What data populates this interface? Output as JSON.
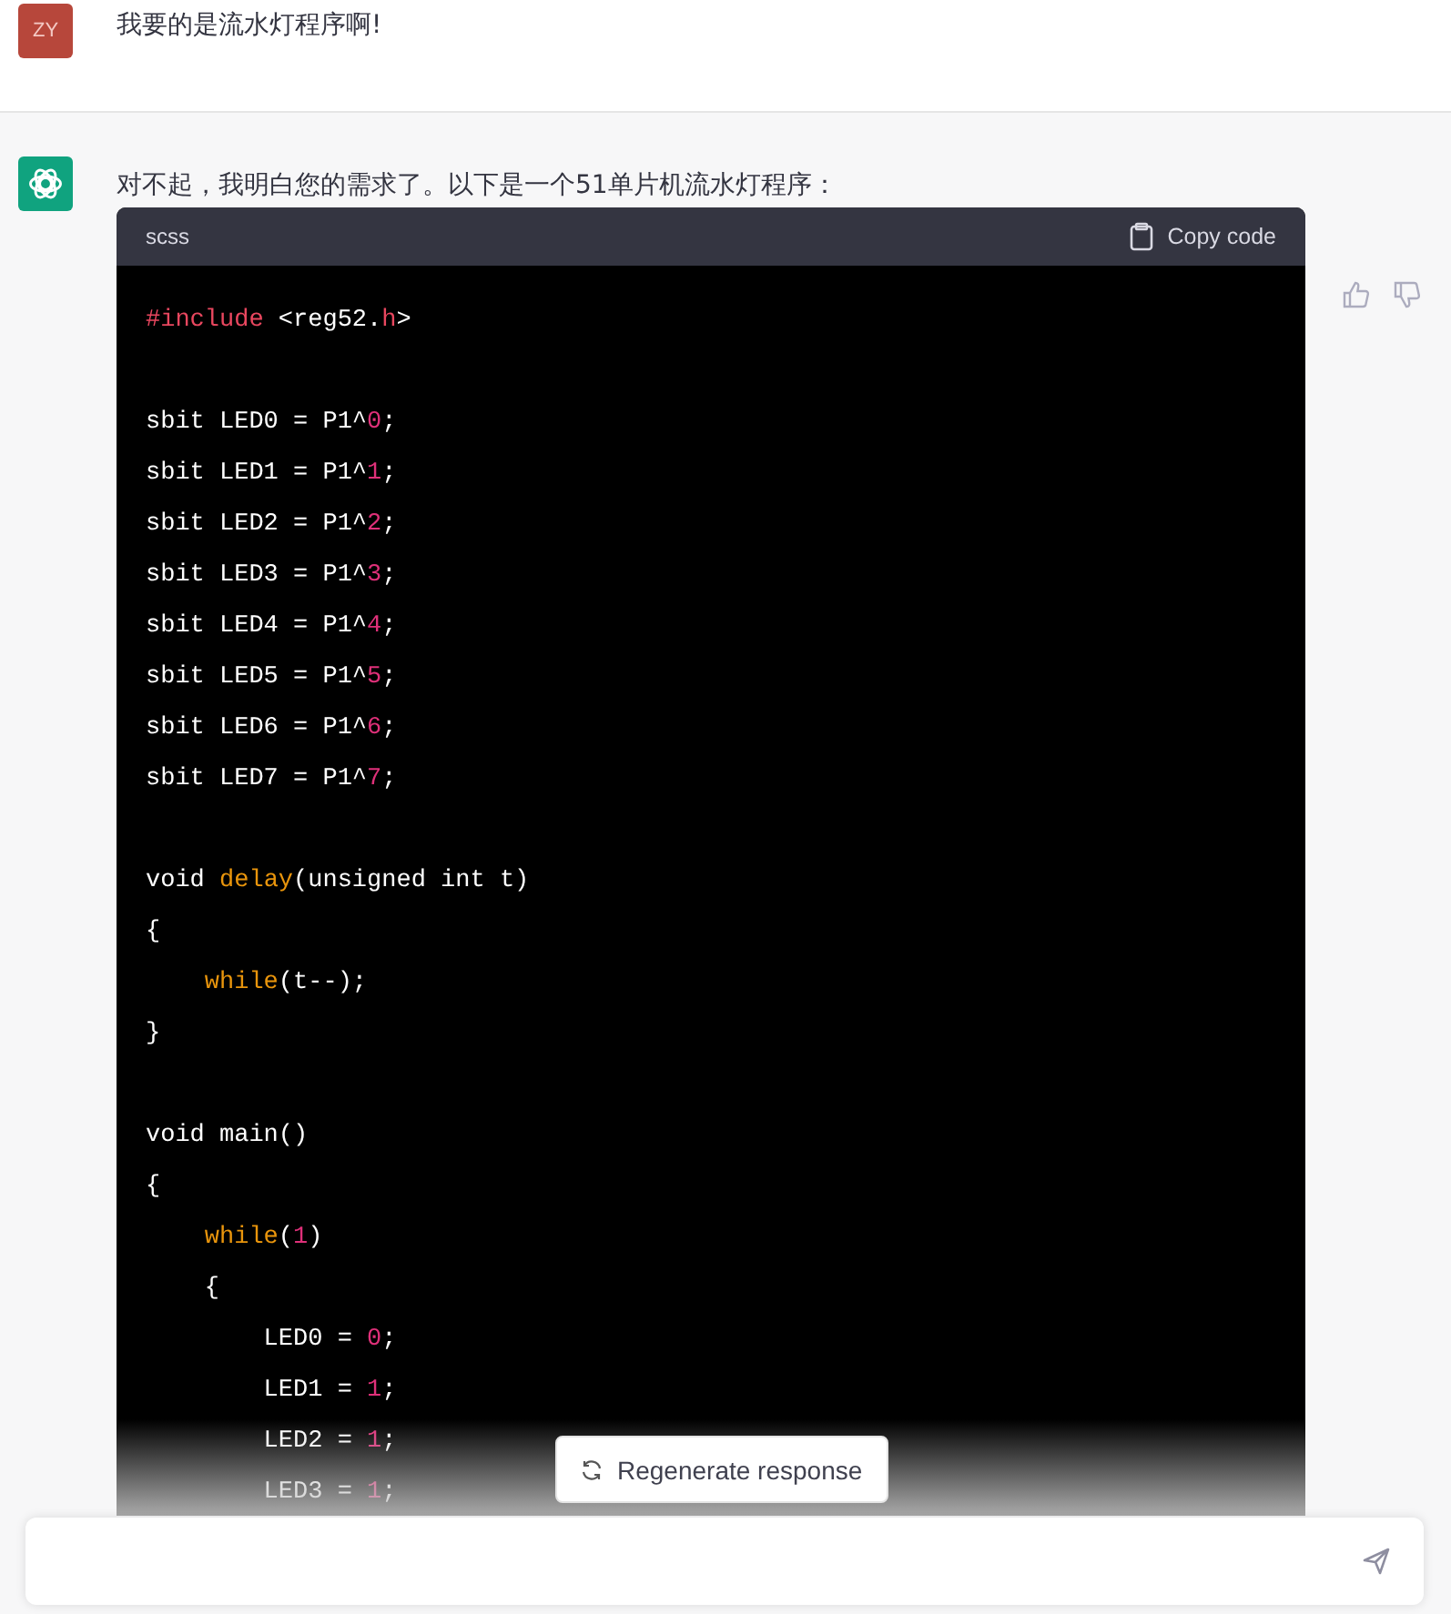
{
  "user_message": {
    "avatar": "ZY",
    "text": "我要的是流水灯程序啊!"
  },
  "assistant_message": {
    "text": "对不起，我明白您的需求了。以下是一个51单片机流水灯程序：",
    "code_block": {
      "language": "scss",
      "copy_label": "Copy code",
      "lines": [
        {
          "kind": "code",
          "segments": [
            {
              "text": "#include ",
              "kind": "keyword"
            },
            {
              "text": "<reg52.",
              "kind": "plain"
            },
            {
              "text": "h",
              "kind": "keyword"
            },
            {
              "text": ">",
              "kind": "plain"
            }
          ]
        },
        {
          "kind": "blank"
        },
        {
          "kind": "code",
          "segments": [
            {
              "text": "sbit LED0 = P1^",
              "kind": "plain"
            },
            {
              "text": "0",
              "kind": "number"
            },
            {
              "text": ";",
              "kind": "plain"
            }
          ]
        },
        {
          "kind": "code",
          "segments": [
            {
              "text": "sbit LED1 = P1^",
              "kind": "plain"
            },
            {
              "text": "1",
              "kind": "number"
            },
            {
              "text": ";",
              "kind": "plain"
            }
          ]
        },
        {
          "kind": "code",
          "segments": [
            {
              "text": "sbit LED2 = P1^",
              "kind": "plain"
            },
            {
              "text": "2",
              "kind": "number"
            },
            {
              "text": ";",
              "kind": "plain"
            }
          ]
        },
        {
          "kind": "code",
          "segments": [
            {
              "text": "sbit LED3 = P1^",
              "kind": "plain"
            },
            {
              "text": "3",
              "kind": "number"
            },
            {
              "text": ";",
              "kind": "plain"
            }
          ]
        },
        {
          "kind": "code",
          "segments": [
            {
              "text": "sbit LED4 = P1^",
              "kind": "plain"
            },
            {
              "text": "4",
              "kind": "number"
            },
            {
              "text": ";",
              "kind": "plain"
            }
          ]
        },
        {
          "kind": "code",
          "segments": [
            {
              "text": "sbit LED5 = P1^",
              "kind": "plain"
            },
            {
              "text": "5",
              "kind": "number"
            },
            {
              "text": ";",
              "kind": "plain"
            }
          ]
        },
        {
          "kind": "code",
          "segments": [
            {
              "text": "sbit LED6 = P1^",
              "kind": "plain"
            },
            {
              "text": "6",
              "kind": "number"
            },
            {
              "text": ";",
              "kind": "plain"
            }
          ]
        },
        {
          "kind": "code",
          "segments": [
            {
              "text": "sbit LED7 = P1^",
              "kind": "plain"
            },
            {
              "text": "7",
              "kind": "number"
            },
            {
              "text": ";",
              "kind": "plain"
            }
          ]
        },
        {
          "kind": "blank"
        },
        {
          "kind": "code",
          "segments": [
            {
              "text": "void ",
              "kind": "plain"
            },
            {
              "text": "delay",
              "kind": "function"
            },
            {
              "text": "(unsigned int t)",
              "kind": "plain"
            }
          ]
        },
        {
          "kind": "code",
          "segments": [
            {
              "text": "{",
              "kind": "plain"
            }
          ]
        },
        {
          "kind": "code",
          "segments": [
            {
              "text": "    while",
              "kind": "function"
            },
            {
              "text": "(t--);",
              "kind": "plain"
            }
          ]
        },
        {
          "kind": "code",
          "segments": [
            {
              "text": "}",
              "kind": "plain"
            }
          ]
        },
        {
          "kind": "blank"
        },
        {
          "kind": "code",
          "segments": [
            {
              "text": "void main()",
              "kind": "plain"
            }
          ]
        },
        {
          "kind": "code",
          "segments": [
            {
              "text": "{",
              "kind": "plain"
            }
          ]
        },
        {
          "kind": "code",
          "segments": [
            {
              "text": "    while",
              "kind": "function"
            },
            {
              "text": "(",
              "kind": "plain"
            },
            {
              "text": "1",
              "kind": "number"
            },
            {
              "text": ")",
              "kind": "plain"
            }
          ]
        },
        {
          "kind": "code",
          "segments": [
            {
              "text": "    {",
              "kind": "plain"
            }
          ]
        },
        {
          "kind": "code",
          "segments": [
            {
              "text": "        LED0 = ",
              "kind": "plain"
            },
            {
              "text": "0",
              "kind": "number"
            },
            {
              "text": ";",
              "kind": "plain"
            }
          ]
        },
        {
          "kind": "code",
          "segments": [
            {
              "text": "        LED1 = ",
              "kind": "plain"
            },
            {
              "text": "1",
              "kind": "number"
            },
            {
              "text": ";",
              "kind": "plain"
            }
          ]
        },
        {
          "kind": "code",
          "segments": [
            {
              "text": "        LED2 = ",
              "kind": "plain"
            },
            {
              "text": "1",
              "kind": "number"
            },
            {
              "text": ";",
              "kind": "plain"
            }
          ]
        },
        {
          "kind": "code",
          "segments": [
            {
              "text": "        LED3 = ",
              "kind": "plain"
            },
            {
              "text": "1",
              "kind": "number"
            },
            {
              "text": ";",
              "kind": "plain"
            }
          ]
        }
      ]
    }
  },
  "regenerate_button": {
    "label": "Regenerate response"
  }
}
